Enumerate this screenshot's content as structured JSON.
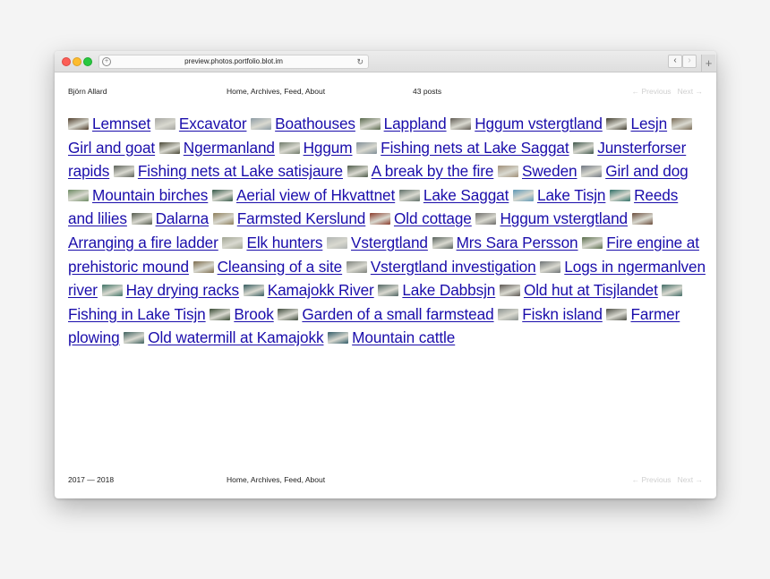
{
  "browser": {
    "url": "preview.photos.portfolio.blot.im"
  },
  "header": {
    "site_name": "Björn Allard",
    "nav": "Home, Archives, Feed, About",
    "post_count": "43 posts",
    "previous": "← Previous",
    "next": "Next →"
  },
  "posts": [
    {
      "title": "Lemnset",
      "color": "#4f3d2b"
    },
    {
      "title": "Excavator",
      "color": "#a5a5a0"
    },
    {
      "title": "Boathouses",
      "color": "#8b9aa3"
    },
    {
      "title": "Lappland",
      "color": "#57674b"
    },
    {
      "title": "Hggum vstergtland",
      "color": "#5f5a52"
    },
    {
      "title": "Lesjn",
      "color": "#3e3a2c"
    },
    {
      "title": "Girl and goat",
      "color": "#786a55"
    },
    {
      "title": "Ngermanland",
      "color": "#494735"
    },
    {
      "title": "Hggum",
      "color": "#6f7a6a"
    },
    {
      "title": "Fishing nets at Lake Saggat",
      "color": "#7f8d96"
    },
    {
      "title": "Junsterforser rapids",
      "color": "#3d5549"
    },
    {
      "title": "Fishing nets at Lake satisjaure",
      "color": "#5a5f57"
    },
    {
      "title": "A break by the fire",
      "color": "#4d5a48"
    },
    {
      "title": "Sweden",
      "color": "#a08f78"
    },
    {
      "title": "Girl and dog",
      "color": "#6e7580"
    },
    {
      "title": "Mountain birches",
      "color": "#6d8a63"
    },
    {
      "title": "Aerial view of Hkvattnet",
      "color": "#335847"
    },
    {
      "title": "Lake Saggat",
      "color": "#5e6e67"
    },
    {
      "title": "Lake Tisjn",
      "color": "#5d98b6"
    },
    {
      "title": "Reeds and lilies",
      "color": "#2f7067"
    },
    {
      "title": "Dalarna",
      "color": "#545a4c"
    },
    {
      "title": "Farmsted Kerslund",
      "color": "#8d7e5a"
    },
    {
      "title": "Old cottage",
      "color": "#8a3b2a"
    },
    {
      "title": "Hggum vstergtland",
      "color": "#6b6a68"
    },
    {
      "title": "Arranging a fire ladder",
      "color": "#6a4d3c"
    },
    {
      "title": "Elk hunters",
      "color": "#a1a593"
    },
    {
      "title": "Vstergtland",
      "color": "#b0b4b2"
    },
    {
      "title": "Mrs Sara Persson",
      "color": "#56605a"
    },
    {
      "title": "Fire engine at prehistoric mound",
      "color": "#576b49"
    },
    {
      "title": "Cleansing of a site",
      "color": "#7c6b4c"
    },
    {
      "title": "Vstergtland investigation",
      "color": "#7e827c"
    },
    {
      "title": "Logs in ngermanlven river",
      "color": "#6d7274"
    },
    {
      "title": "Hay drying racks",
      "color": "#3e7264"
    },
    {
      "title": "Kamajokk River",
      "color": "#335a5d"
    },
    {
      "title": "Lake Dabbsjn",
      "color": "#4f6461"
    },
    {
      "title": "Old hut at Tisjlandet",
      "color": "#5a5550"
    },
    {
      "title": "Fishing in Lake Tisjn",
      "color": "#3f6a63"
    },
    {
      "title": "Brook",
      "color": "#384a33"
    },
    {
      "title": "Garden of a small farmstead",
      "color": "#3e4a3b"
    },
    {
      "title": "Fiskn island",
      "color": "#8a918e"
    },
    {
      "title": "Farmer plowing",
      "color": "#4d4f45"
    },
    {
      "title": "Old watermill at Kamajokk",
      "color": "#3c5f5c"
    },
    {
      "title": "Mountain cattle",
      "color": "#2f5a66"
    }
  ],
  "footer": {
    "years": "2017 — 2018",
    "nav": "Home, Archives, Feed, About",
    "previous": "← Previous",
    "next": "Next →"
  },
  "colors": {
    "link": "#1a0dab",
    "pager_disabled": "#d0d0d0"
  }
}
